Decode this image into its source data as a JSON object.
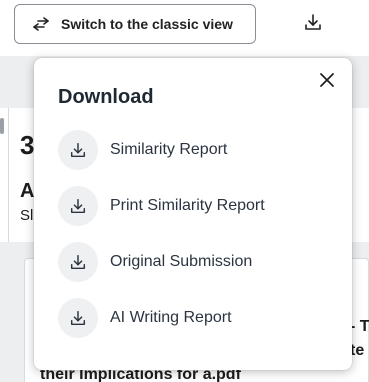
{
  "toolbar": {
    "classic_view_label": "Switch to the classic view",
    "classic_view_icon": "swap-arrows-icon",
    "download_icon": "download-icon"
  },
  "background": {
    "score_fragment": "3",
    "heading_fragment": "A",
    "subheading_fragment": "Sl",
    "text_fragment_1": "- T",
    "text_fragment_2": "te",
    "filename_fragment": "their Implications for a.pdf"
  },
  "download_menu": {
    "title": "Download",
    "close_icon": "close-icon",
    "items": [
      {
        "label": "Similarity Report",
        "icon": "download-icon"
      },
      {
        "label": "Print Similarity Report",
        "icon": "download-icon"
      },
      {
        "label": "Original Submission",
        "icon": "download-icon"
      },
      {
        "label": "AI Writing Report",
        "icon": "download-icon"
      }
    ]
  },
  "colors": {
    "page_background": "#eceef0",
    "icon_circle": "#eef0f2",
    "text": "#1f2933"
  }
}
